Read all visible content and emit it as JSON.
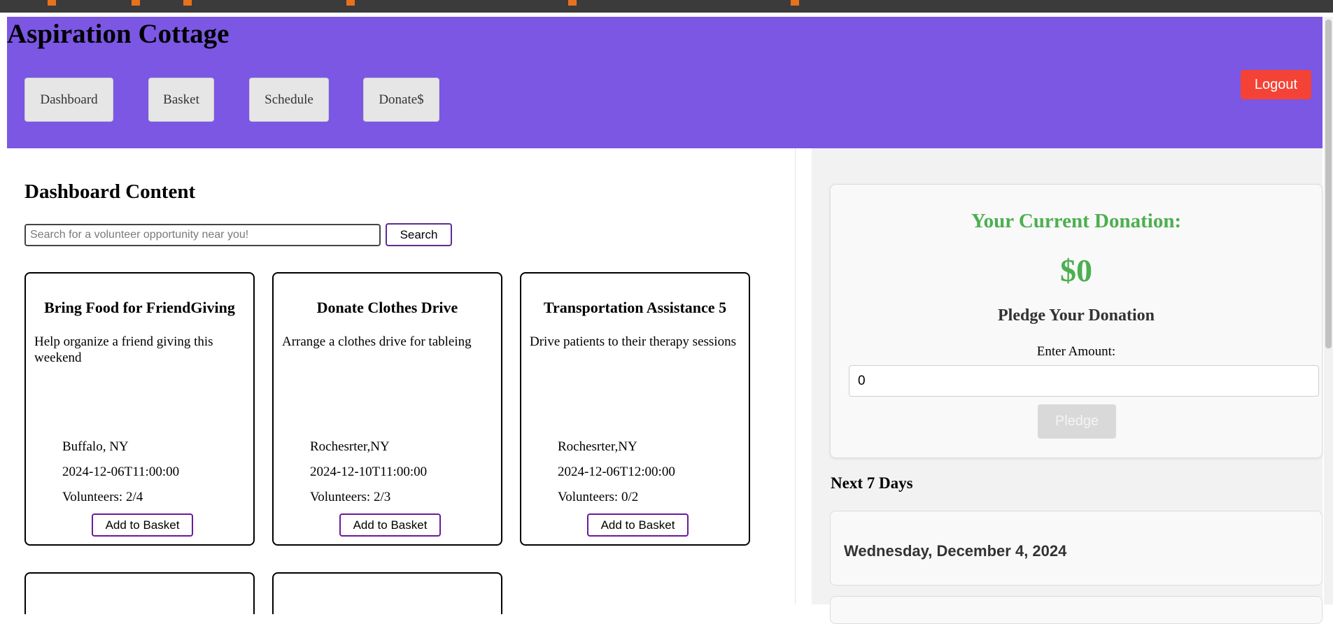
{
  "app": {
    "title": "Aspiration Cottage"
  },
  "nav": {
    "items": [
      {
        "label": "Dashboard"
      },
      {
        "label": "Basket"
      },
      {
        "label": "Schedule"
      },
      {
        "label": "Donate$"
      }
    ],
    "logout_label": "Logout"
  },
  "dashboard": {
    "title": "Dashboard Content",
    "search": {
      "placeholder": "Search for a volunteer opportunity near you!",
      "value": "",
      "button_label": "Search"
    },
    "cards": [
      {
        "title": "Bring Food for FriendGiving",
        "description": "Help organize a friend giving this weekend",
        "location": "Buffalo, NY",
        "datetime": "2024-12-06T11:00:00",
        "volunteers": "Volunteers: 2/4",
        "button_label": "Add to Basket"
      },
      {
        "title": "Donate Clothes Drive",
        "description": "Arrange a clothes drive for tableing",
        "location": "Rochesrter,NY",
        "datetime": "2024-12-10T11:00:00",
        "volunteers": "Volunteers: 2/3",
        "button_label": "Add to Basket"
      },
      {
        "title": "Transportation Assistance 5",
        "description": "Drive patients to their therapy sessions",
        "location": "Rochesrter,NY",
        "datetime": "2024-12-06T12:00:00",
        "volunteers": "Volunteers: 0/2",
        "button_label": "Add to Basket"
      }
    ]
  },
  "donation": {
    "heading": "Your Current Donation:",
    "amount": "$0",
    "pledge_heading": "Pledge Your Donation",
    "amount_label": "Enter Amount:",
    "amount_value": "0",
    "pledge_button": "Pledge"
  },
  "schedule": {
    "heading": "Next 7 Days",
    "days": [
      {
        "label": "Wednesday, December 4, 2024"
      }
    ]
  },
  "colors": {
    "header_bg": "#7b57e4",
    "logout_bg": "#f44336",
    "donation_green": "#4caf50"
  }
}
